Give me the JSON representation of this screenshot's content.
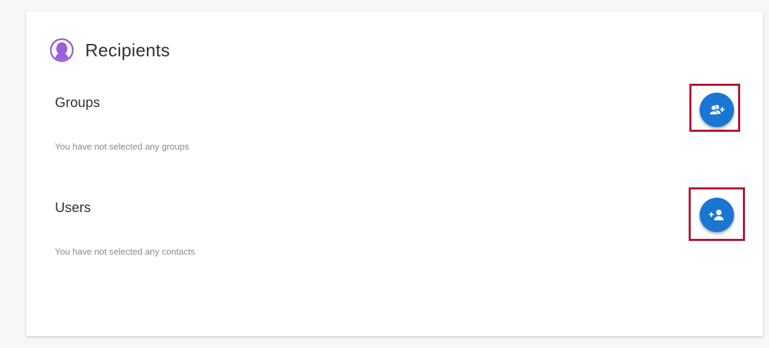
{
  "header": {
    "title": "Recipients",
    "icon": "recipients-icon",
    "icon_color": "#9b5fd6"
  },
  "groups": {
    "title": "Groups",
    "empty_text": "You have not selected any groups",
    "add_button_icon": "add-group-icon"
  },
  "users": {
    "title": "Users",
    "empty_text": "You have not selected any contacts",
    "add_button_icon": "add-user-icon"
  },
  "colors": {
    "accent": "#1976d2",
    "highlight": "#b5122e",
    "background": "#f7f7f7",
    "card": "#ffffff"
  }
}
